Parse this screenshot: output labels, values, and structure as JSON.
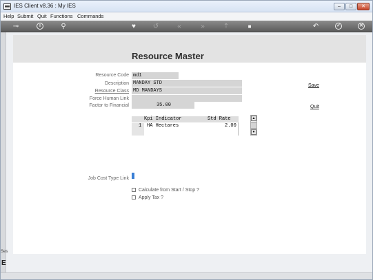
{
  "window": {
    "title": "IES Client v8.36 : My IES",
    "min_glyph": "–",
    "max_glyph": "□",
    "close_glyph": "✕"
  },
  "menu": {
    "items": [
      "Help",
      "Submit",
      "Quit",
      "Functions",
      "Commands"
    ]
  },
  "toolbar": {
    "icons": [
      "key-icon",
      "info-icon",
      "search-icon",
      "heart-icon",
      "refresh-icon",
      "rewind-icon",
      "fast-forward-icon",
      "upload-icon",
      "stop-icon",
      "back-icon",
      "ok-icon",
      "close-icon"
    ],
    "info_glyph": "i",
    "search_glyph": "⚲",
    "heart_glyph": "♥",
    "refresh_glyph": "↺",
    "rewind_glyph": "«",
    "forward_glyph": "»",
    "upload_glyph": "⇡",
    "stop_glyph": "■",
    "back_glyph": "↶",
    "ok_glyph": "✓",
    "close_glyph": "✕",
    "key_glyph": "⊸"
  },
  "sidebar": {
    "session_label": "Ses",
    "session_icon_glyph": "E"
  },
  "form": {
    "title": "Resource Master",
    "fields": {
      "resource_code": {
        "label": "Resource Code",
        "value": "md1"
      },
      "description": {
        "label": "Description",
        "value": "MANDAY STD"
      },
      "resource_class": {
        "label": "Resource Class",
        "value": "MD MANDAYS"
      },
      "force_human_link": {
        "label": "Force Human Link",
        "value": ""
      },
      "factor_to_financial": {
        "label": "Factor to Financial",
        "value": "35.00"
      },
      "job_cost_type_link": {
        "label": "Job Cost Type Link",
        "value": ""
      }
    },
    "links": {
      "save": "Save",
      "quit": "Quit"
    },
    "kpi_table": {
      "headers": [
        "Kpi Indicator",
        "Std Rate"
      ],
      "rows": [
        {
          "num": "1",
          "indicator": "HA Hectares",
          "rate": "2.00"
        }
      ]
    },
    "scroll": {
      "up_glyph": "▲",
      "down_glyph": "▼"
    },
    "checkboxes": {
      "calculate": "Calculate from Start / Stop ?",
      "apply_tax": "Apply Tax ?"
    }
  }
}
